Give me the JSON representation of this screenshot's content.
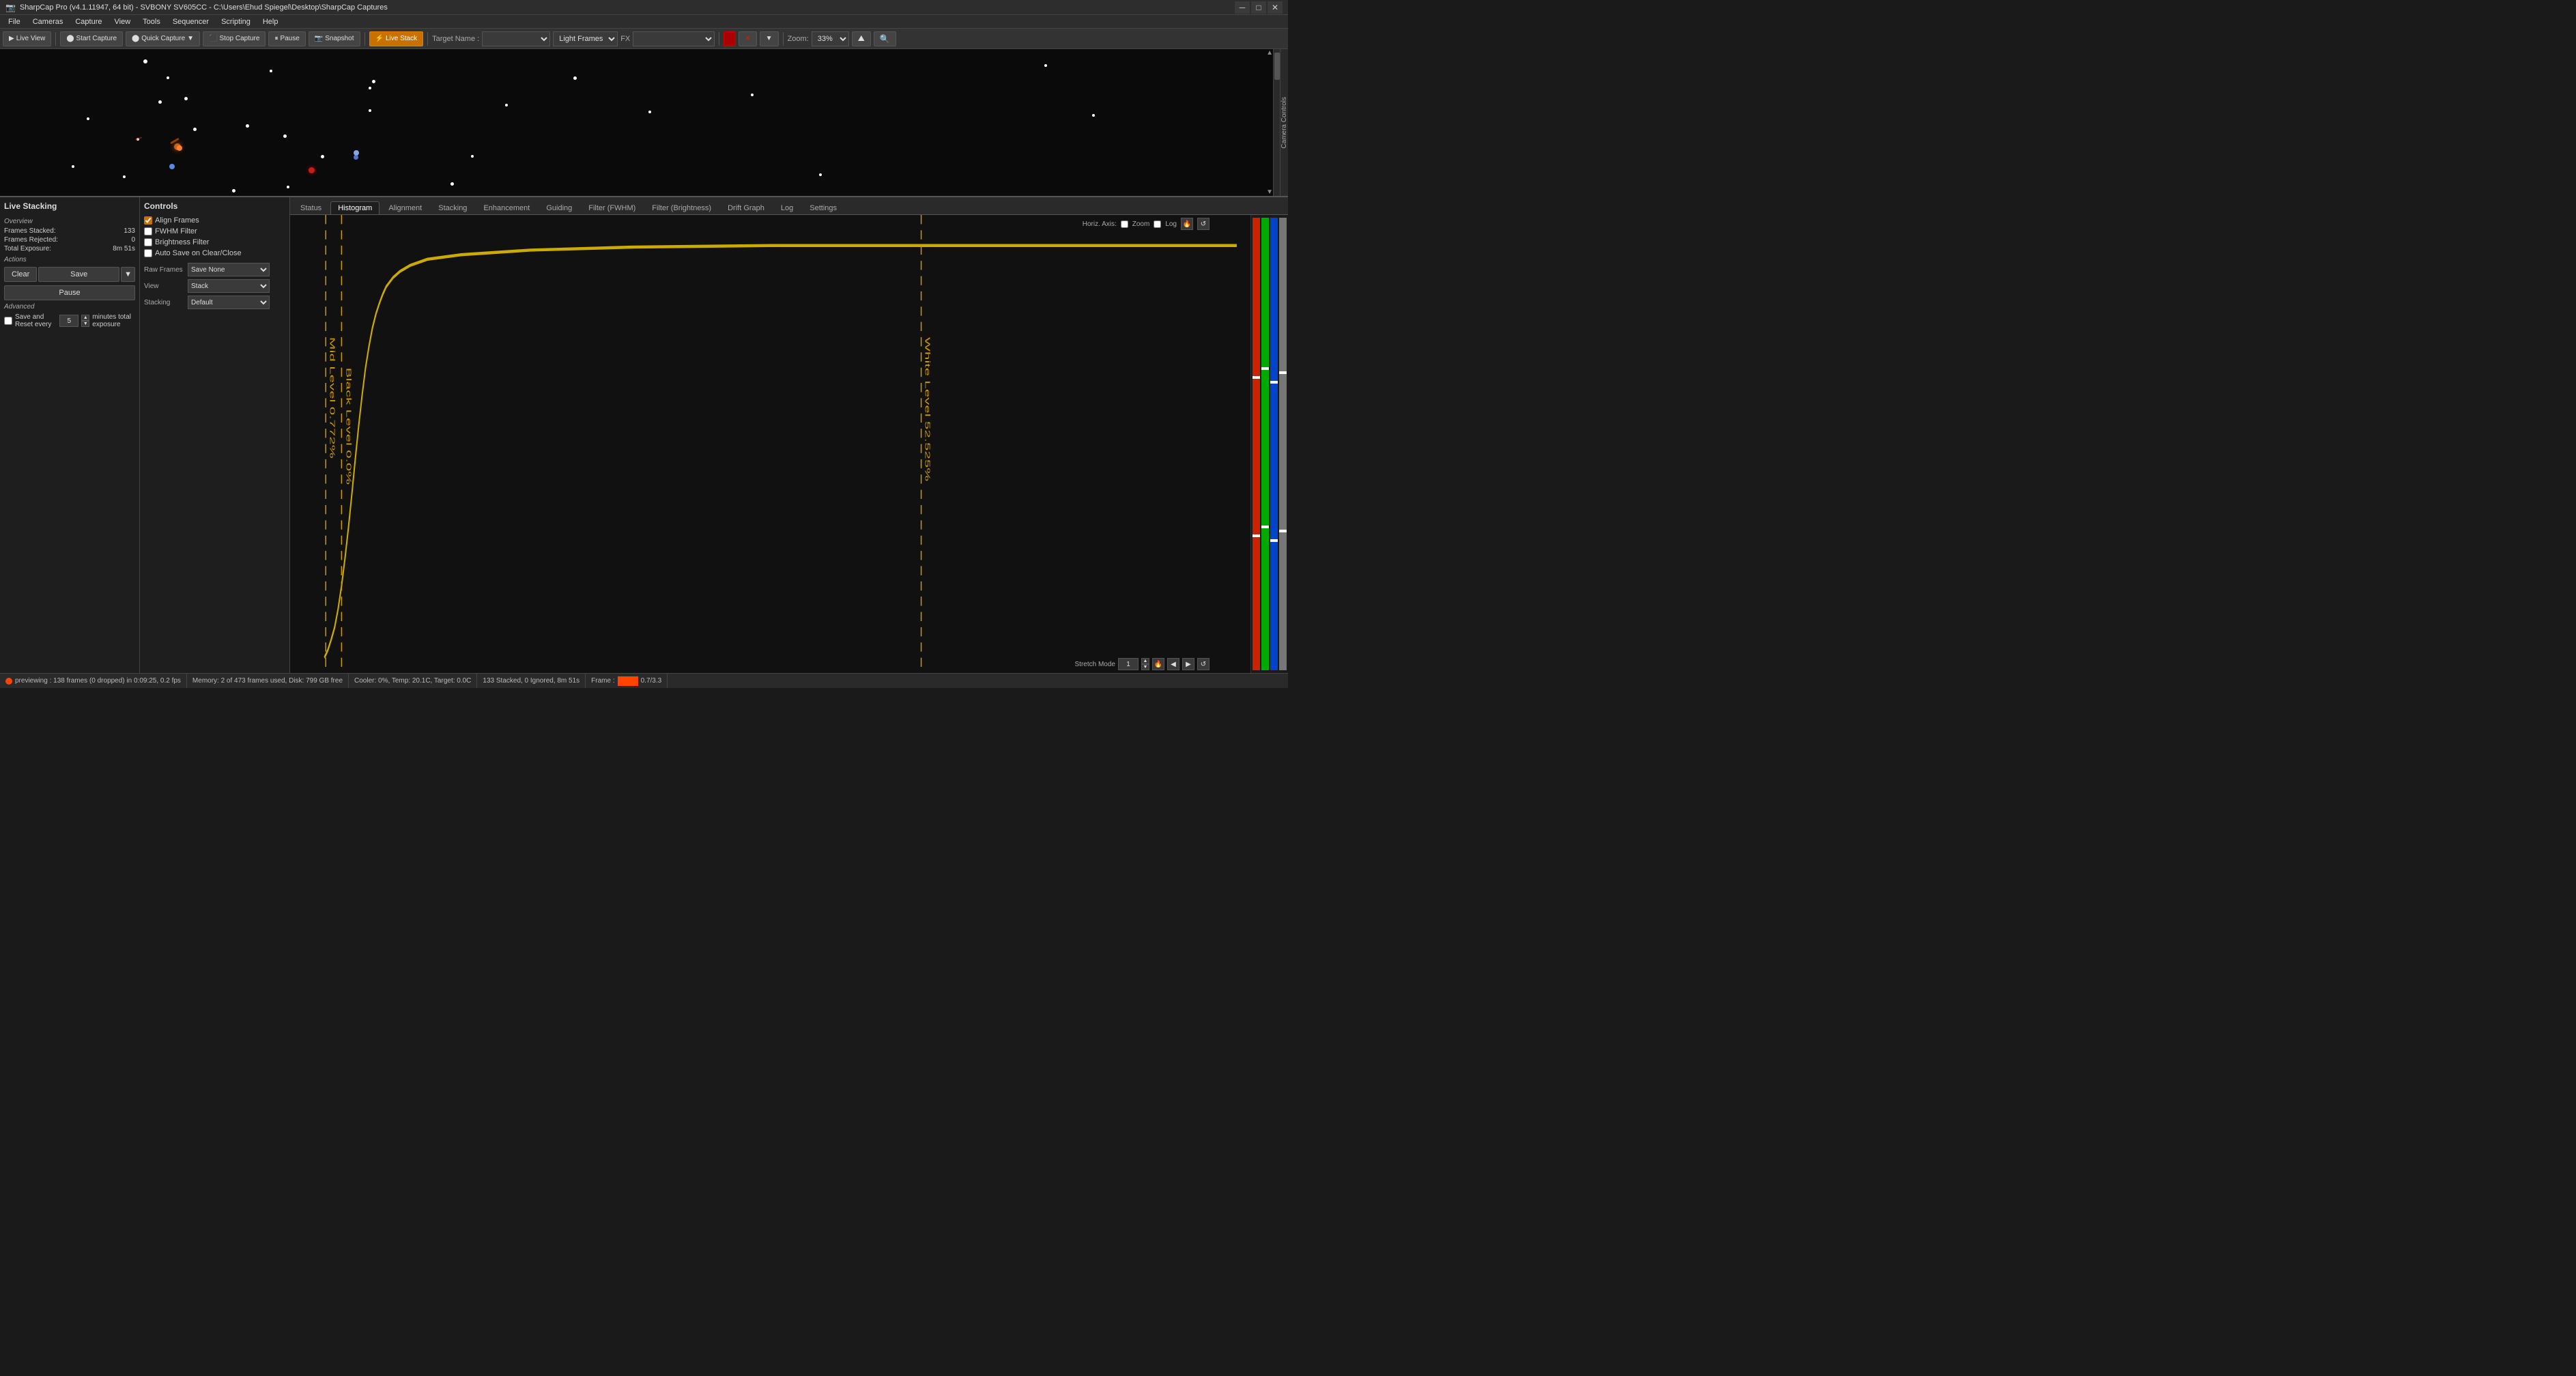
{
  "title_bar": {
    "title": "SharpCap Pro (v4.1.11947, 64 bit) - SVBONY SV605CC - C:\\Users\\Ehud Spiegel\\Desktop\\SharpCap Captures",
    "min_label": "─",
    "max_label": "□",
    "close_label": "✕"
  },
  "menu": {
    "items": [
      "File",
      "Cameras",
      "Capture",
      "View",
      "Tools",
      "Sequencer",
      "Scripting",
      "Help"
    ]
  },
  "toolbar": {
    "live_view_label": "Live View",
    "start_capture_label": "Start Capture",
    "quick_capture_label": "Quick Capture",
    "stop_capture_label": "Stop Capture",
    "pause_label": "Pause",
    "snapshot_label": "Snapshot",
    "live_stack_label": "Live Stack",
    "target_name_label": "Target Name :",
    "light_frames_label": "Light Frames",
    "fx_label": "FX",
    "zoom_label": "Zoom:",
    "zoom_value": "33%"
  },
  "live_stacking": {
    "panel_title": "Live Stacking",
    "overview_label": "Overview",
    "frames_stacked_label": "Frames Stacked:",
    "frames_stacked_value": "133",
    "frames_rejected_label": "Frames Rejected:",
    "frames_rejected_value": "0",
    "total_exposure_label": "Total Exposure:",
    "total_exposure_value": "8m 51s",
    "actions_label": "Actions",
    "clear_label": "Clear",
    "save_label": "Save",
    "pause_label": "Pause",
    "advanced_label": "Advanced",
    "save_reset_label": "Save and Reset every",
    "save_reset_value": "5",
    "minutes_label": "minutes total exposure"
  },
  "controls": {
    "panel_title": "Controls",
    "align_frames_label": "Align Frames",
    "align_frames_checked": true,
    "fwhm_filter_label": "FWHM Filter",
    "fwhm_filter_checked": false,
    "brightness_filter_label": "Brightness Filter",
    "brightness_filter_checked": false,
    "auto_save_label": "Auto Save on Clear/Close",
    "auto_save_checked": false,
    "raw_frames_label": "Raw Frames",
    "raw_frames_value": "Save None",
    "view_label": "View",
    "view_value": "Stack",
    "stacking_label": "Stacking",
    "stacking_value": "Default"
  },
  "tabs": {
    "items": [
      "Status",
      "Histogram",
      "Alignment",
      "Stacking",
      "Enhancement",
      "Guiding",
      "Filter (FWHM)",
      "Filter (Brightness)",
      "Drift Graph",
      "Log",
      "Settings"
    ],
    "active": "Histogram"
  },
  "histogram": {
    "horiz_axis_label": "Horiz. Axis:",
    "zoom_label": "Zoom",
    "log_label": "Log",
    "mid_level_label": "Mid Level",
    "mid_level_value": "0.772%",
    "black_level_label": "Black Level",
    "black_level_value": "0.0%",
    "white_level_label": "White Level",
    "white_level_value": "52.525%",
    "stretch_mode_label": "Stretch Mode",
    "stretch_value": "1",
    "icon_fire": "🔥",
    "icon_refresh": "↺",
    "icon_left": "◀",
    "icon_right": "▶",
    "icon_refresh2": "↺"
  },
  "status_bar": {
    "previewing": "previewing : 138 frames (0 dropped) in 0:09:25, 0.2 fps",
    "memory": "Memory: 2 of 473 frames used, Disk: 799 GB free",
    "cooler": "Cooler: 0%, Temp: 20.1C, Target: 0.0C",
    "stacked": "133 Stacked, 0 Ignored, 8m 51s",
    "frame": "Frame :",
    "frame_value": "0.7/3.3",
    "indicator_color": "#ff4400"
  },
  "camera_sidebar": {
    "label": "Camera Controls"
  }
}
